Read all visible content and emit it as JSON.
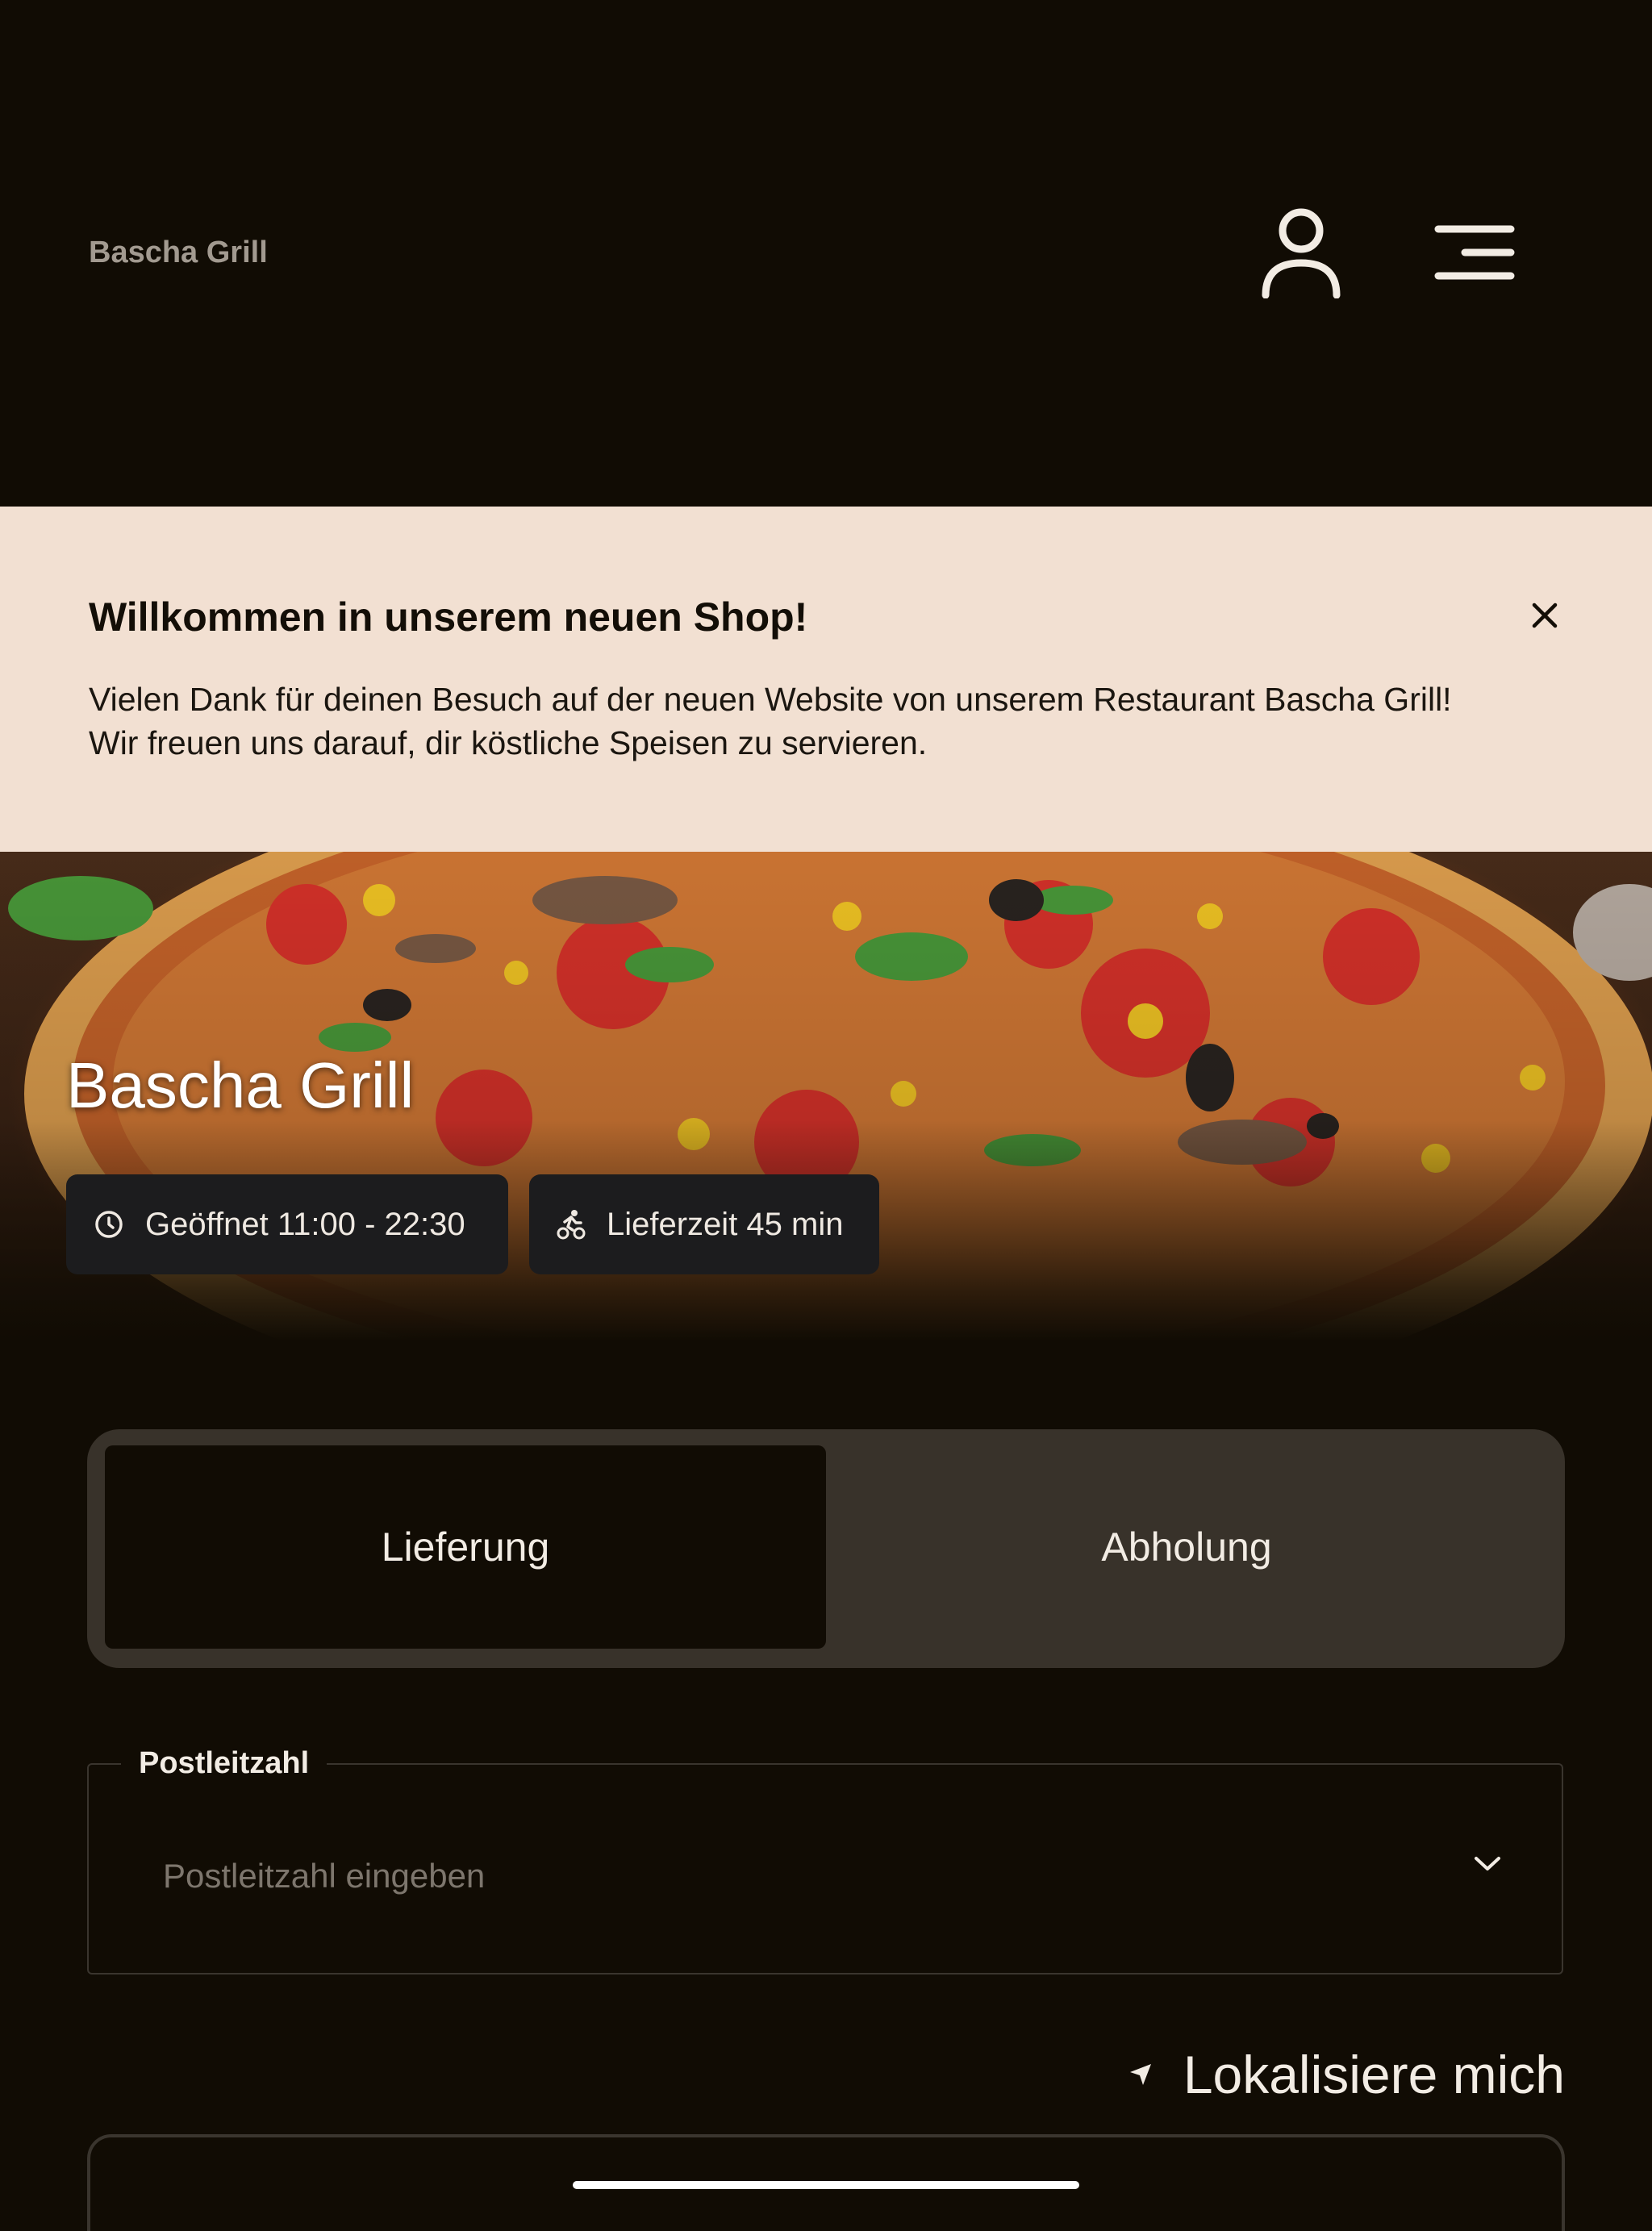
{
  "header": {
    "logo_text": "Bascha Grill",
    "user_icon": "user-icon",
    "menu_icon": "hamburger-menu-icon"
  },
  "banner": {
    "title": "Willkommen in unserem neuen Shop!",
    "line1": "Vielen Dank für deinen Besuch auf der neuen Website von unserem Restaurant Bascha Grill!",
    "line2": "Wir freuen uns darauf, dir köstliche Speisen zu servieren.",
    "close_icon": "close-icon"
  },
  "hero": {
    "title": "Bascha Grill",
    "opening": "Geöffnet 11:00 - 22:30",
    "delivery_time": "Lieferzeit 45 min"
  },
  "order_mode": {
    "options": [
      "Lieferung",
      "Abholung"
    ],
    "selected": "Lieferung"
  },
  "postcode": {
    "label": "Postleitzahl",
    "placeholder": "Postleitzahl eingeben",
    "value": ""
  },
  "locate": {
    "label": "Lokalisiere mich"
  },
  "colors": {
    "background": "#110c04",
    "banner": "#f2e0d2",
    "toggle_track": "#38322a",
    "chip": "#1c1c1e"
  }
}
